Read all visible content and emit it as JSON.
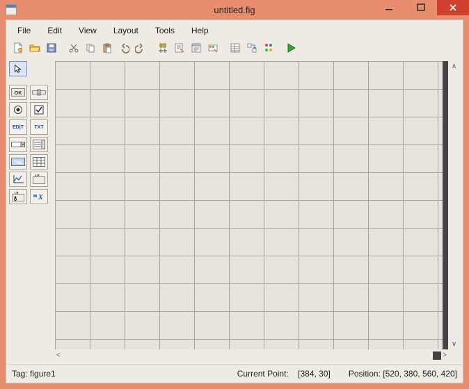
{
  "window": {
    "title": "untitled.fig"
  },
  "menu": {
    "file": "File",
    "edit": "Edit",
    "view": "View",
    "layout": "Layout",
    "tools": "Tools",
    "help": "Help"
  },
  "toolbar": {
    "new": "New",
    "open": "Open",
    "save": "Save",
    "cut": "Cut",
    "copy": "Copy",
    "paste": "Paste",
    "undo": "Undo",
    "redo": "Redo",
    "align": "Align",
    "editor": "Editor",
    "menu_editor": "Menu Editor",
    "toolbar_editor": "Toolbar Editor",
    "property": "Property Inspector",
    "tab_order": "Tab Order",
    "object_browser": "Object Browser",
    "run": "Run"
  },
  "toolbox": {
    "select": "Select",
    "push": "Push Button",
    "slider": "Slider",
    "radio": "Radio Button",
    "check": "Check Box",
    "edit": "Edit Text",
    "text": "Static Text",
    "popup": "Pop-up Menu",
    "listbox": "Listbox",
    "toggle": "Toggle Button",
    "table": "Table",
    "axes": "Axes",
    "panel": "Panel",
    "bgroup": "Button Group",
    "activex": "ActiveX Control"
  },
  "status": {
    "tag_label": "Tag:",
    "tag_value": "figure1",
    "curpoint_label": "Current Point:",
    "curpoint_value": "[384, 30]",
    "position_label": "Position:",
    "position_value": "[520, 380, 560, 420]"
  }
}
